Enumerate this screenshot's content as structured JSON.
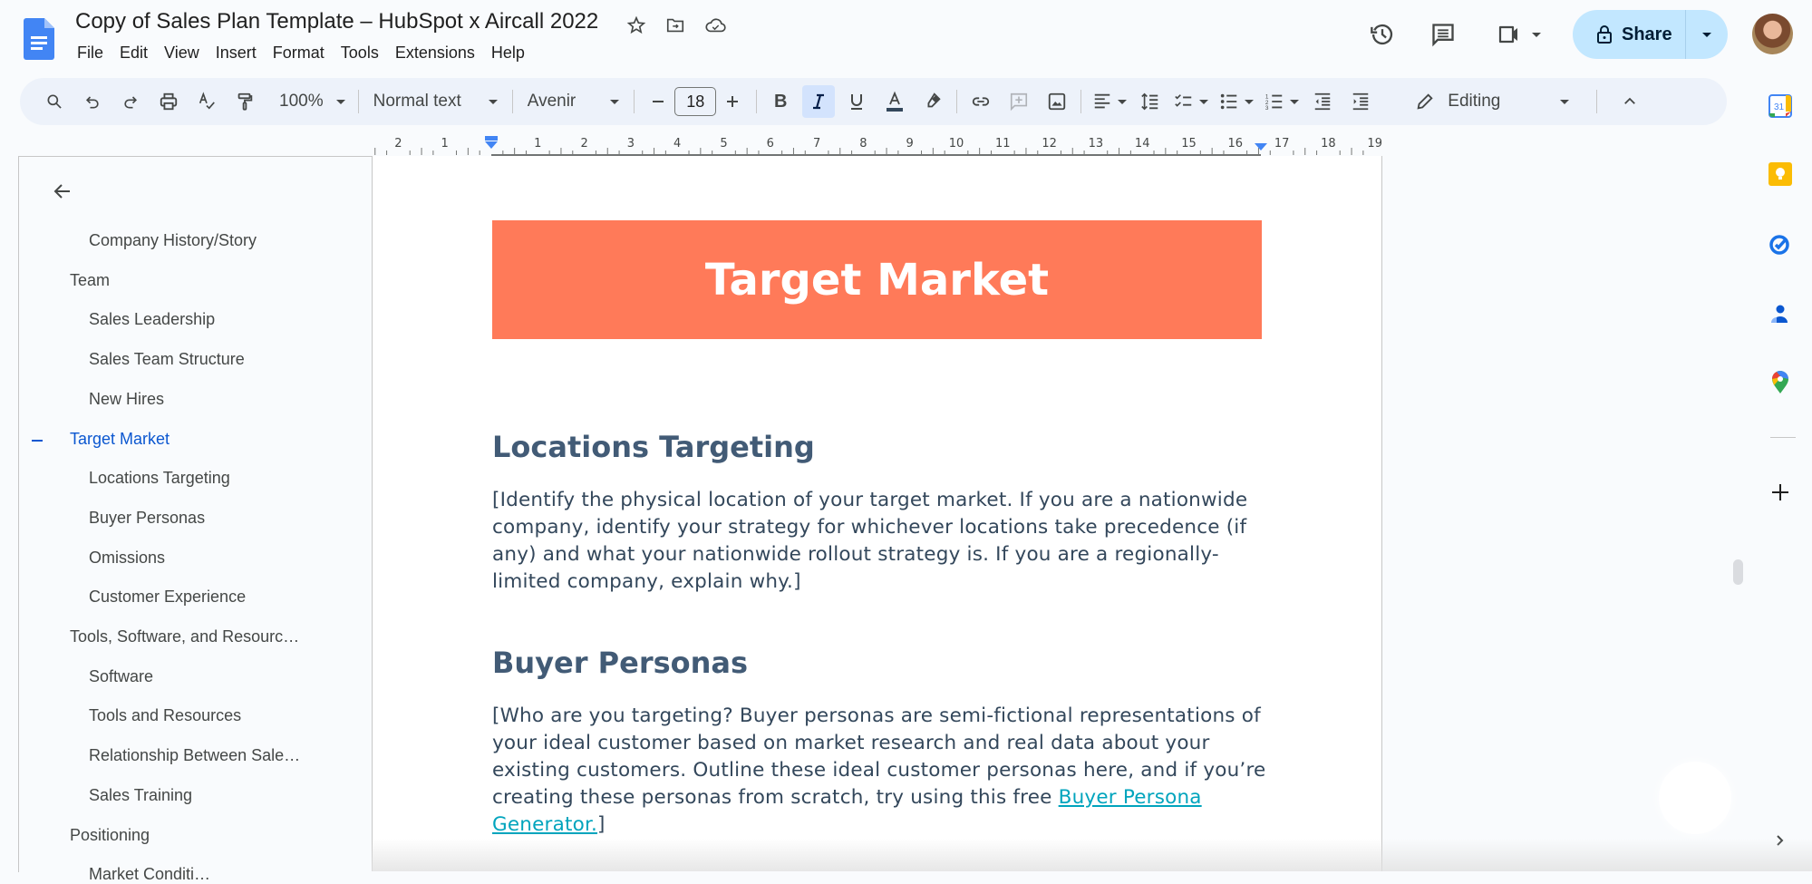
{
  "header": {
    "title": "Copy of Sales Plan Template – HubSpot x Aircall 2022",
    "menu": [
      "File",
      "Edit",
      "View",
      "Insert",
      "Format",
      "Tools",
      "Extensions",
      "Help"
    ],
    "share_label": "Share"
  },
  "toolbar": {
    "zoom": "100%",
    "style": "Normal text",
    "font": "Avenir",
    "font_size": "18",
    "mode": "Editing"
  },
  "ruler": {
    "ticks": [
      "2",
      "1",
      "1",
      "2",
      "3",
      "4",
      "5",
      "6",
      "7",
      "8",
      "9",
      "10",
      "11",
      "12",
      "13",
      "14",
      "15",
      "16",
      "17",
      "18",
      "19"
    ]
  },
  "outline": {
    "items": [
      {
        "label": "Company History/Story",
        "level": 2,
        "active": false
      },
      {
        "label": "Team",
        "level": 1,
        "active": false
      },
      {
        "label": "Sales Leadership",
        "level": 2,
        "active": false
      },
      {
        "label": "Sales Team Structure",
        "level": 2,
        "active": false
      },
      {
        "label": "New Hires",
        "level": 2,
        "active": false
      },
      {
        "label": "Target Market",
        "level": 1,
        "active": true
      },
      {
        "label": "Locations Targeting",
        "level": 2,
        "active": false
      },
      {
        "label": "Buyer Personas",
        "level": 2,
        "active": false
      },
      {
        "label": "Omissions",
        "level": 2,
        "active": false
      },
      {
        "label": "Customer Experience",
        "level": 2,
        "active": false
      },
      {
        "label": "Tools, Software, and Resourc…",
        "level": 1,
        "active": false
      },
      {
        "label": "Software",
        "level": 2,
        "active": false
      },
      {
        "label": "Tools and Resources",
        "level": 2,
        "active": false
      },
      {
        "label": "Relationship Between Sale…",
        "level": 2,
        "active": false
      },
      {
        "label": "Sales Training",
        "level": 2,
        "active": false
      },
      {
        "label": "Positioning",
        "level": 1,
        "active": false
      },
      {
        "label": "Market Conditi…",
        "level": 2,
        "active": false
      }
    ]
  },
  "document": {
    "banner": "Target Market",
    "sections": [
      {
        "heading": "Locations Targeting",
        "body": "[Identify the physical location of your target market. If you are a nationwide company, identify your strategy for whichever locations take precedence (if any) and what your nationwide rollout strategy is. If you are a regionally-limited company, explain why.]"
      },
      {
        "heading": "Buyer Personas",
        "body_before_link": "[Who are you targeting? Buyer personas are semi-fictional representations of your ideal customer based on market research and real data about your existing customers. Outline these ideal customer personas here, and if you’re creating these personas from scratch, try using this free ",
        "link": "Buyer Persona Generator.",
        "body_after_link": "]"
      }
    ]
  },
  "colors": {
    "banner": "#ff7a59",
    "heading": "#425b76",
    "body": "#33475b",
    "link": "#00a4bd",
    "accent": "#0b57d0",
    "share_bg": "#c2e7ff"
  }
}
